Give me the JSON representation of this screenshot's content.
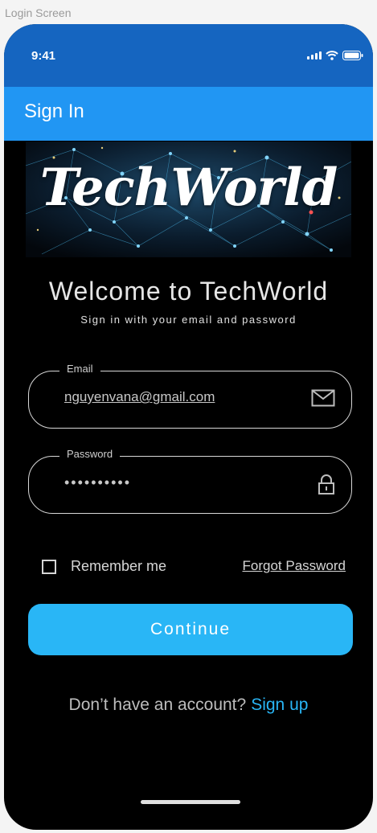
{
  "frame_label": "Login Screen",
  "status_bar": {
    "time": "9:41"
  },
  "app_bar": {
    "title": "Sign In"
  },
  "banner": {
    "text": "TechWorld"
  },
  "welcome": {
    "title": "Welcome to TechWorld",
    "subtitle": "Sign in with your email and password"
  },
  "email_field": {
    "label": "Email",
    "value": "nguyenvana@gmail.com",
    "icon": "mail-icon"
  },
  "password_field": {
    "label": "Password",
    "value": "••••••••••",
    "icon": "lock-icon"
  },
  "remember": {
    "label": "Remember me",
    "checked": false
  },
  "forgot_password": "Forgot Password",
  "continue_label": "Continue",
  "signup": {
    "prompt": "Don’t have an account?",
    "link": "Sign up"
  },
  "colors": {
    "status_bar": "#1565c0",
    "app_bar": "#2196f3",
    "accent": "#29b6f6",
    "background": "#000000"
  }
}
